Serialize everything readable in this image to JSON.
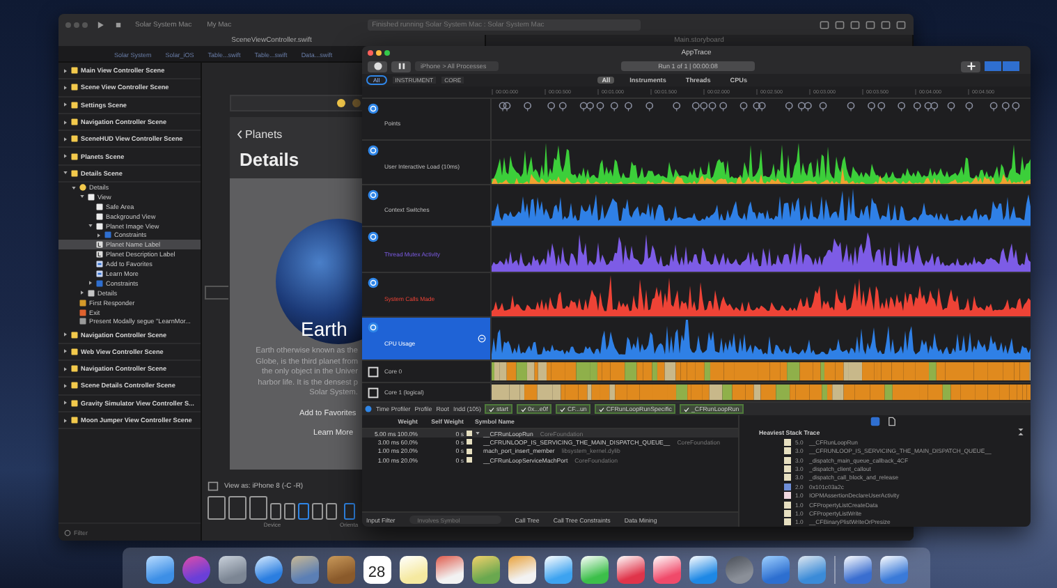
{
  "xcode": {
    "toolbar": {
      "scheme": "Solar System Mac",
      "device": "My Mac",
      "status": "Finished running Solar System Mac : Solar System Mac"
    },
    "tabs": [
      {
        "label": "SceneViewController.swift",
        "selected": true
      },
      {
        "label": "Main.storyboard",
        "selected": false
      }
    ],
    "jump_bar": [
      "Solar System",
      "Solar_iOS",
      "Table...swift",
      "Table...swift",
      "Data...swift"
    ],
    "outline": [
      {
        "label": "Main View Controller Scene",
        "kind": "scene",
        "expanded": false,
        "selected": false
      },
      {
        "label": "Scene View Controller Scene",
        "kind": "scene",
        "expanded": false,
        "selected": false
      },
      {
        "label": "Settings Scene",
        "kind": "scene",
        "expanded": false,
        "selected": false
      },
      {
        "label": "Navigation Controller Scene",
        "kind": "scene",
        "expanded": false,
        "selected": false
      },
      {
        "label": "SceneHUD View Controller Scene",
        "kind": "scene",
        "expanded": false,
        "selected": false
      },
      {
        "label": "Planets Scene",
        "kind": "scene",
        "expanded": false,
        "selected": false
      },
      {
        "label": "Details Scene",
        "kind": "scene",
        "expanded": true,
        "selected": false,
        "children": [
          {
            "label": "Details",
            "kind": "controller",
            "expanded": true,
            "selected": false,
            "children": [
              {
                "label": "View",
                "kind": "view",
                "expanded": true,
                "selected": false,
                "children": [
                  {
                    "label": "Safe Area",
                    "kind": "view",
                    "selected": false
                  },
                  {
                    "label": "Background View",
                    "kind": "view",
                    "selected": false
                  },
                  {
                    "label": "Planet Image View",
                    "kind": "view",
                    "expanded": true,
                    "selected": false,
                    "children": [
                      {
                        "label": "Constraints",
                        "kind": "constraints",
                        "expanded": false,
                        "selected": false
                      }
                    ]
                  },
                  {
                    "label": "Planet Name Label",
                    "kind": "label",
                    "selected": true
                  },
                  {
                    "label": "Planet Description Label",
                    "kind": "label",
                    "selected": false
                  },
                  {
                    "label": "Add to Favorites",
                    "kind": "button",
                    "selected": false
                  },
                  {
                    "label": "Learn More",
                    "kind": "button",
                    "selected": false
                  },
                  {
                    "label": "Constraints",
                    "kind": "constraints",
                    "expanded": false,
                    "selected": false
                  }
                ]
              },
              {
                "label": "Details",
                "kind": "navitem",
                "expanded": false,
                "selected": false
              }
            ]
          },
          {
            "label": "First Responder",
            "kind": "responder",
            "selected": false
          },
          {
            "label": "Exit",
            "kind": "exit",
            "selected": false
          },
          {
            "label": "Present Modally segue \"LearnMor...",
            "kind": "segue",
            "selected": false
          }
        ]
      },
      {
        "label": "Navigation Controller Scene",
        "kind": "scene",
        "expanded": false,
        "selected": false
      },
      {
        "label": "Web View Controller Scene",
        "kind": "scene",
        "expanded": false,
        "selected": false
      },
      {
        "label": "Navigation Controller Scene",
        "kind": "scene",
        "expanded": false,
        "selected": false
      },
      {
        "label": "Scene Details Controller Scene",
        "kind": "scene",
        "expanded": false,
        "selected": false
      },
      {
        "label": "Gravity Simulator View Controller S...",
        "kind": "scene",
        "expanded": false,
        "selected": false
      },
      {
        "label": "Moon Jumper View Controller Scene",
        "kind": "scene",
        "expanded": false,
        "selected": false
      }
    ],
    "filter": {
      "placeholder": "Filter"
    },
    "canvas": {
      "back_label": "Planets",
      "title": "Details",
      "planet_name": "Earth",
      "description": [
        "Earth otherwise known as the",
        "Globe, is the third planet from",
        "the only object in the Univer",
        "harbor life. It is the densest p",
        "Solar System."
      ],
      "buttons": [
        "Add to Favorites",
        "Learn More"
      ],
      "view_as": "View as: iPhone 8 (-C -R)",
      "device_label": "Device",
      "orientation_label": "Orienta"
    }
  },
  "instruments": {
    "title": "AppTrace",
    "target": "iPhone > All Processes",
    "run": "Run 1 of 1 | 00:00:08",
    "scope": "All",
    "filters": [
      "INSTRUMENT",
      "CORE"
    ],
    "tabs": [
      {
        "label": "All",
        "selected": true
      },
      {
        "label": "Instruments",
        "selected": false
      },
      {
        "label": "Threads",
        "selected": false
      },
      {
        "label": "CPUs",
        "selected": false
      }
    ],
    "ruler": [
      "00:00.000",
      "00:00.500",
      "00:01.000",
      "00:01.500",
      "00:02.000",
      "00:02.500",
      "00:03.000",
      "00:03.500",
      "00:04.000",
      "00:04.500"
    ],
    "tracks": [
      {
        "label": "Points",
        "kind": "points",
        "color": "#8a8fa0",
        "selected": false
      },
      {
        "label": "User Interactive Load (10ms)",
        "kind": "graph",
        "color": "#3ccf3a",
        "selected": false
      },
      {
        "label": "Context Switches",
        "kind": "graph",
        "color": "#2f80e6",
        "selected": false
      },
      {
        "label": "Thread Mutex Activity",
        "kind": "graph",
        "color": "#7d5ce6",
        "selected": false
      },
      {
        "label": "System Calls Made",
        "kind": "graph",
        "color": "#ee4336",
        "selected": false
      },
      {
        "label": "CPU Usage",
        "kind": "graph",
        "color": "#2f80e6",
        "selected": true
      },
      {
        "label": "Core 0",
        "kind": "core",
        "color": "#e08a1e",
        "selected": false
      },
      {
        "label": "Core 1 (logical)",
        "kind": "core",
        "color": "#e08a1e",
        "selected": false
      }
    ],
    "breadcrumb": [
      "Time Profiler",
      "Profile",
      "Root",
      "Indd (105)"
    ],
    "frames": [
      "start",
      "0x...e0f",
      "CF...un",
      "CFRunLoopRunSpecific",
      "_CFRunLoopRun"
    ],
    "columns": [
      "Weight",
      "Self Weight",
      "Symbol Name"
    ],
    "rows": [
      {
        "weight": "5.00 ms",
        "percent": "100.0%",
        "self": "0 s",
        "symbol": "__CFRunLoopRun",
        "library": "CoreFoundation",
        "expanded": true
      },
      {
        "weight": "3.00 ms",
        "percent": "60.0%",
        "self": "0 s",
        "symbol": "__CFRUNLOOP_IS_SERVICING_THE_MAIN_DISPATCH_QUEUE__",
        "library": "CoreFoundation",
        "expanded": false
      },
      {
        "weight": "1.00 ms",
        "percent": "20.0%",
        "self": "0 s",
        "symbol": "mach_port_insert_member",
        "library": "libsystem_kernel.dylib",
        "expanded": false
      },
      {
        "weight": "1.00 ms",
        "percent": "20.0%",
        "self": "0 s",
        "symbol": "__CFRunLoopServiceMachPort",
        "library": "CoreFoundation",
        "expanded": false
      }
    ],
    "bottom_bar": {
      "filter_label": "Input Filter",
      "placeholder": "Involves Symbol",
      "buttons": [
        "Call Tree",
        "Call Tree Constraints",
        "Data Mining"
      ]
    },
    "stack_title": "Heaviest Stack Trace",
    "stack": [
      {
        "count": "5.0",
        "symbol": "__CFRunLoopRun",
        "color": "#e6dfc0"
      },
      {
        "count": "3.0",
        "symbol": "__CFRUNLOOP_IS_SERVICING_THE_MAIN_DISPATCH_QUEUE__",
        "color": "#e6dfc0"
      },
      {
        "count": "3.0",
        "symbol": "_dispatch_main_queue_callback_4CF",
        "color": "#e6dfc0"
      },
      {
        "count": "3.0",
        "symbol": "_dispatch_client_callout",
        "color": "#e6dfc0"
      },
      {
        "count": "3.0",
        "symbol": "_dispatch_call_block_and_release",
        "color": "#e6dfc0"
      },
      {
        "count": "2.0",
        "symbol": "0x101c03a2c",
        "color": "#6f8fd8"
      },
      {
        "count": "1.0",
        "symbol": "IOPMAssertionDeclareUserActivity",
        "color": "#f0d8e0"
      },
      {
        "count": "1.0",
        "symbol": "CFPropertyListCreateData",
        "color": "#e6dfc0"
      },
      {
        "count": "1.0",
        "symbol": "CFPropertyListWrite",
        "color": "#e6dfc0"
      },
      {
        "count": "1.0",
        "symbol": "__CFBinaryPlistWriteOrPresize",
        "color": "#e6dfc0"
      }
    ]
  },
  "dock": {
    "calendar_day": "28"
  }
}
